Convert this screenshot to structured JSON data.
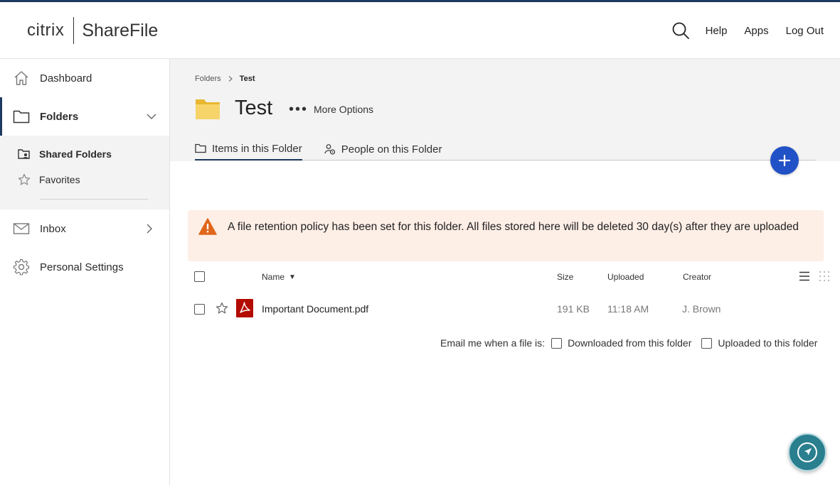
{
  "header": {
    "logo_citrix": "citrix",
    "logo_product": "ShareFile",
    "links": {
      "help": "Help",
      "apps": "Apps",
      "logout": "Log Out"
    }
  },
  "sidebar": {
    "dashboard": "Dashboard",
    "folders": "Folders",
    "shared_folders": "Shared Folders",
    "favorites": "Favorites",
    "inbox": "Inbox",
    "personal_settings": "Personal Settings"
  },
  "breadcrumb": {
    "root": "Folders",
    "current": "Test"
  },
  "folder": {
    "title": "Test",
    "more_options": "More Options"
  },
  "tabs": {
    "items": "Items in this Folder",
    "people": "People on this Folder"
  },
  "notice": {
    "text": "A file retention policy has been set for this folder. All files stored here will be deleted 30 day(s) after they are uploaded"
  },
  "table": {
    "columns": {
      "name": "Name",
      "size": "Size",
      "uploaded": "Uploaded",
      "creator": "Creator"
    },
    "rows": [
      {
        "name": "Important Document.pdf",
        "size": "191 KB",
        "uploaded": "11:18 AM",
        "creator": "J. Brown"
      }
    ]
  },
  "email_notify": {
    "label": "Email me when a file is:",
    "downloaded": "Downloaded from this folder",
    "uploaded": "Uploaded to this folder"
  },
  "colors": {
    "accent_blue": "#2151c6",
    "nav_border": "#1f3a5f",
    "notice_bg": "#fdeee6",
    "warning": "#e0661a",
    "pdf_red": "#b30b00",
    "fab_teal": "#2a7f8f"
  }
}
